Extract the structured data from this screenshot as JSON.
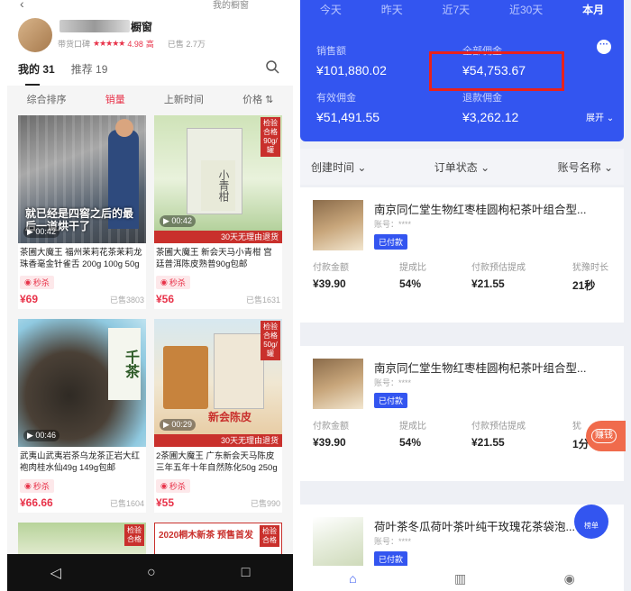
{
  "left": {
    "top_link": "我的橱窗",
    "shop": {
      "name_suffix": "橱窗",
      "rating_label": "带货口碑",
      "rating_value": "4.98",
      "rating_level": "高",
      "sold_text": "已售 2.7万"
    },
    "tabs": [
      {
        "label": "我的 31"
      },
      {
        "label": "推荐 19"
      }
    ],
    "sort": [
      "综合排序",
      "销量",
      "上新时间",
      "价格"
    ],
    "products": [
      {
        "caption": "就已经是四窖之后的最后一道烘干了",
        "video_time": "00:42",
        "title": "茶圃大魔王 福州茉莉花茶茉莉龙珠香毫金针雀舌 200g 100g 50g",
        "tag": "秒杀",
        "price": "¥69",
        "sold": "已售3803"
      },
      {
        "caption": "小青柑",
        "video_time": "00:42",
        "banner": "30天无理由退货",
        "badge": "检验合格",
        "weight": "90g/罐",
        "title": "茶圃大魔王 新会天马小青柑 宫廷普洱陈皮熟普90g包邮",
        "tag": "秒杀",
        "price": "¥56",
        "sold": "已售1631"
      },
      {
        "caption": "千茶",
        "video_time": "00:46",
        "title": "武夷山武夷岩茶乌龙茶正岩大红袍肉桂水仙49g 149g包邮",
        "tag": "秒杀",
        "price": "¥66.66",
        "sold": "已售1604"
      },
      {
        "caption": "新会陈皮",
        "video_time": "00:29",
        "banner": "30天无理由退货",
        "badge": "检验合格",
        "weight": "50g/罐",
        "title": "2茶圃大魔王 广东新会天马陈皮三年五年十年自然陈化50g 250g",
        "tag": "秒杀",
        "price": "¥55",
        "sold": "已售990"
      }
    ],
    "promo": "2020桐木新茶 预售首发",
    "promo_badge": "检验合格"
  },
  "right": {
    "periods": [
      "今天",
      "昨天",
      "近7天",
      "近30天",
      "本月"
    ],
    "stats": {
      "sales_label": "销售额",
      "sales_value": "¥101,880.02",
      "commission_label": "全部佣金",
      "commission_value": "¥54,753.67",
      "valid_label": "有效佣金",
      "valid_value": "¥51,491.55",
      "refund_label": "退款佣金",
      "refund_value": "¥3,262.12"
    },
    "expand_label": "展开",
    "filters": [
      "创建时间",
      "订单状态",
      "账号名称"
    ],
    "orders": [
      {
        "name": "南京同仁堂生物红枣桂圆枸杞茶叶组合型...",
        "account": "账号：****",
        "status": "已付款",
        "labels": [
          "付款金额",
          "提成比",
          "付款预估提成",
          "犹豫时长"
        ],
        "values": [
          "¥39.90",
          "54%",
          "¥21.55",
          "21秒"
        ]
      },
      {
        "name": "南京同仁堂生物红枣桂圆枸杞茶叶组合型...",
        "account": "账号：****",
        "status": "已付款",
        "labels": [
          "付款金额",
          "提成比",
          "付款预估提成",
          "犹"
        ],
        "values": [
          "¥39.90",
          "54%",
          "¥21.55",
          "1分"
        ]
      },
      {
        "name": "荷叶茶冬瓜荷叶茶叶纯干玫瑰花茶袋泡...",
        "account": "账号：****",
        "status": "已付款"
      }
    ],
    "float_earn": "赚钱",
    "float_drop": "榜单"
  },
  "colors": {
    "brand_blue": "#3355f0",
    "price_red": "#e8334a",
    "highlight_red": "#e8211c"
  }
}
